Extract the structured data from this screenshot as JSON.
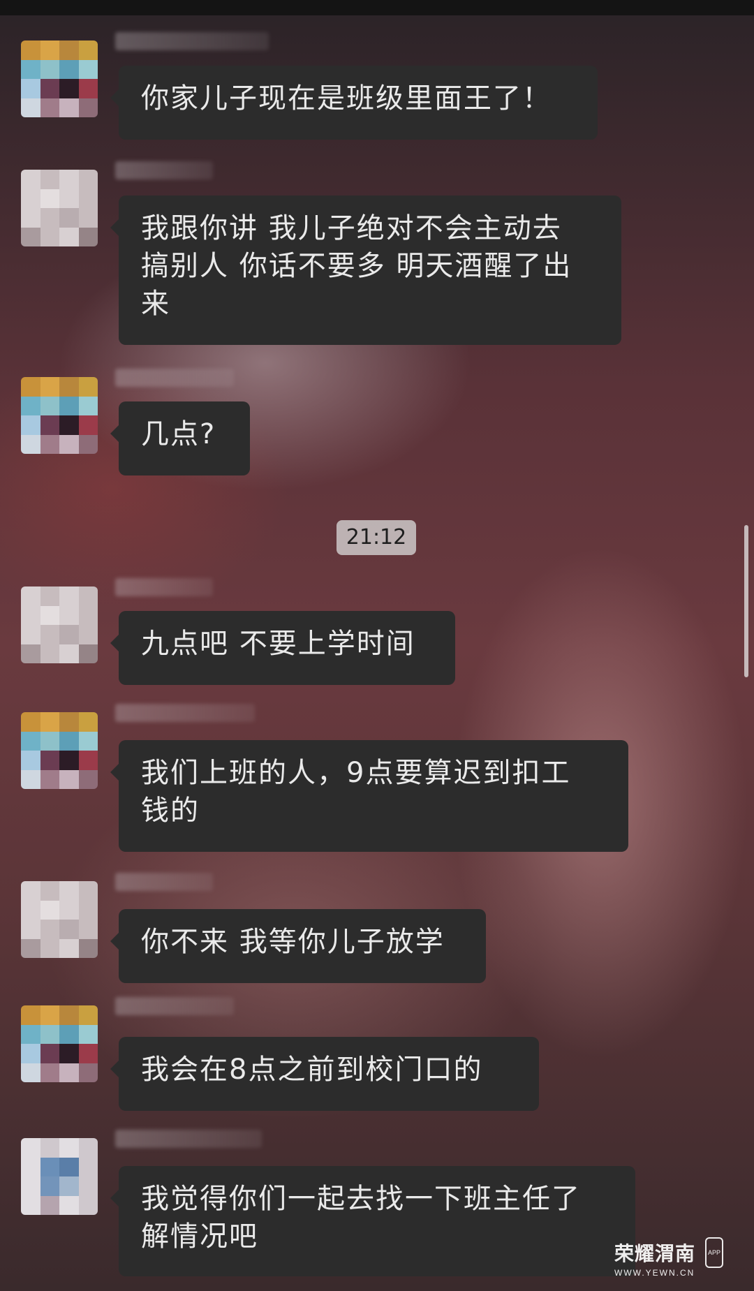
{
  "chat": {
    "messages": [
      {
        "avatar_style": "colorful",
        "text": "你家儿子现在是班级里面王了！"
      },
      {
        "avatar_style": "pale",
        "text": "我跟你讲 我儿子绝对不会主动去\n搞别人 你话不要多 明天酒醒了出\n来"
      },
      {
        "avatar_style": "colorful",
        "text": "几点?"
      },
      {
        "avatar_style": "pale",
        "text": "九点吧 不要上学时间"
      },
      {
        "avatar_style": "colorful",
        "text": "我们上班的人，9点要算迟到扣工\n钱的"
      },
      {
        "avatar_style": "pale",
        "text": "你不来 我等你儿子放学"
      },
      {
        "avatar_style": "colorful",
        "text": "我会在8点之前到校门口的"
      },
      {
        "avatar_style": "blue",
        "text": "我觉得你们一起去找一下班主任了\n解情况吧"
      }
    ],
    "timestamp": "21:12"
  },
  "watermark": {
    "title": "荣耀渭南",
    "url": "WWW.YEWN.CN",
    "app_badge": "APP"
  },
  "colors": {
    "bubble_bg": "#2c2c2c",
    "bubble_text": "#eaeaea",
    "time_chip_bg": "#cdc8c8"
  }
}
